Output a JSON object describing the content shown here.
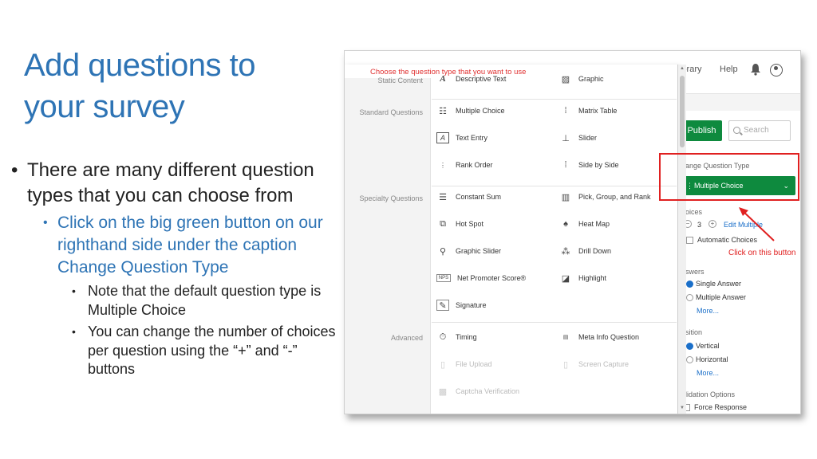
{
  "slide": {
    "title_line1": "Add questions to",
    "title_line2": "your survey",
    "bullet1": "There are many different question types that you can choose from",
    "bullet2": "Click on the big green button on our righthand side under the caption Change Question Type",
    "bullet3a": "Note that the default question type is Multiple Choice",
    "bullet3b": "You can change the number of choices per question using the “+” and “-” buttons"
  },
  "popup": {
    "header": "Choose the question type that you want to use",
    "sections": {
      "static": "Static Content",
      "standard": "Standard Questions",
      "specialty": "Specialty Questions",
      "advanced": "Advanced"
    },
    "items": {
      "descriptive_text": "Descriptive Text",
      "graphic": "Graphic",
      "multiple_choice": "Multiple Choice",
      "matrix_table": "Matrix Table",
      "text_entry": "Text Entry",
      "slider": "Slider",
      "rank_order": "Rank Order",
      "side_by_side": "Side by Side",
      "constant_sum": "Constant Sum",
      "pick_group_rank": "Pick, Group, and Rank",
      "hot_spot": "Hot Spot",
      "heat_map": "Heat Map",
      "graphic_slider": "Graphic Slider",
      "drill_down": "Drill Down",
      "nps": "Net Promoter Score®",
      "highlight": "Highlight",
      "signature": "Signature",
      "timing": "Timing",
      "meta_info": "Meta Info Question",
      "file_upload": "File Upload",
      "screen_capture": "Screen Capture",
      "captcha": "Captcha Verification"
    },
    "icons": {
      "nps_label": "NPS"
    }
  },
  "topbar": {
    "library": "ibrary",
    "help": "Help"
  },
  "editor": {
    "publish": "Publish",
    "search_placeholder": "Search",
    "change_qt_label": "hange Question Type",
    "multiple_choice_btn": "Multiple Choice",
    "choices_label": "hoices",
    "choices_count": "3",
    "edit_multiple": "Edit Multiple",
    "automatic_choices": "Automatic Choices",
    "answers_label": "nswers",
    "single_answer": "Single Answer",
    "multiple_answer": "Multiple Answer",
    "more1": "More...",
    "position_label": "osition",
    "vertical": "Vertical",
    "horizontal": "Horizontal",
    "more2": "More...",
    "validation_label": "alidation Options",
    "force_response": "Force Response"
  },
  "annotation": {
    "click_text": "Click on this button",
    "color": "#e02020"
  },
  "colors": {
    "title_blue": "#2E74B5",
    "green": "#0e8a3e",
    "link_blue": "#1a6fc9"
  }
}
